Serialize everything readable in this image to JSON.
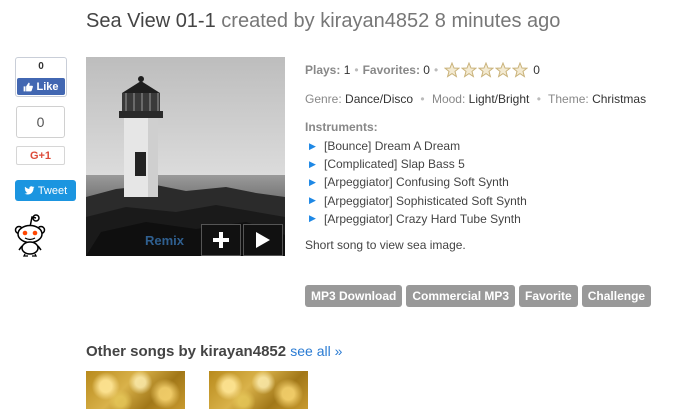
{
  "header": {
    "song_title": "Sea View 01-1",
    "created_by_text": "created by",
    "author": "kirayan4852",
    "time_ago": "8 minutes ago"
  },
  "social": {
    "fb_count": "0",
    "fb_like_label": "Like",
    "gplus_count": "0",
    "gplus_label": "G+1",
    "tweet_label": "Tweet",
    "reddit_icon": "reddit-alien-icon"
  },
  "artwork": {
    "remix_label": "Remix",
    "add_icon": "plus-icon",
    "play_icon": "play-icon"
  },
  "stats": {
    "plays_label": "Plays:",
    "plays_value": "1",
    "favorites_label": "Favorites:",
    "favorites_value": "0",
    "rating_stars": 0,
    "rating_max": 5,
    "rating_count": "0"
  },
  "tags": {
    "genre_label": "Genre:",
    "genre_value": "Dance/Disco",
    "mood_label": "Mood:",
    "mood_value": "Light/Bright",
    "theme_label": "Theme:",
    "theme_value": "Christmas"
  },
  "instruments": {
    "label": "Instruments:",
    "items": [
      "[Bounce] Dream A Dream",
      "[Complicated] Slap Bass 5",
      "[Arpeggiator] Confusing Soft Synth",
      "[Arpeggiator] Sophisticated Soft Synth",
      "[Arpeggiator] Crazy Hard Tube Synth"
    ]
  },
  "description": "Short song to view sea image.",
  "actions": {
    "mp3_download": "MP3 Download",
    "commercial_mp3": "Commercial MP3",
    "favorite": "Favorite",
    "challenge": "Challenge"
  },
  "other_songs": {
    "heading": "Other songs by kirayan4852",
    "see_all": "see all »"
  },
  "colors": {
    "facebook": "#4267b2",
    "twitter": "#1b95e0",
    "gplus": "#dd4b39",
    "link": "#2a7bd3",
    "button_gray": "#999999",
    "arrow_blue": "#1e88e5"
  }
}
